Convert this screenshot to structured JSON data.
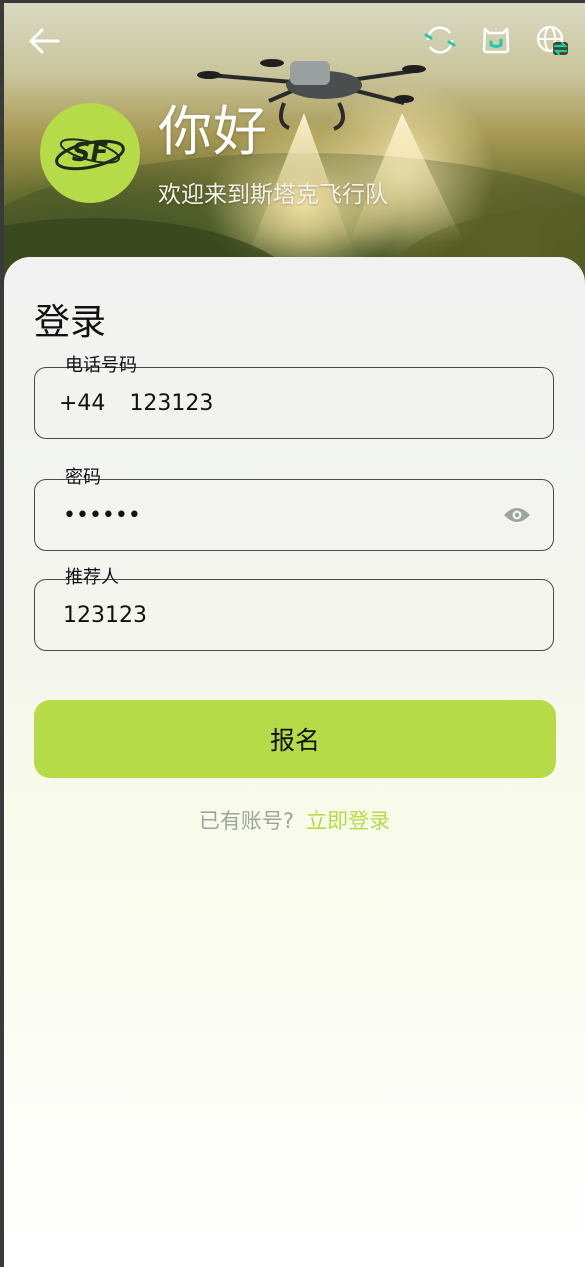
{
  "header": {
    "greeting": "你好",
    "welcome": "欢迎来到斯塔克飞行队",
    "logo_text": "SF",
    "back_icon": "arrow-left-icon",
    "icons": [
      "refresh-icon",
      "support-icon",
      "language-icon"
    ]
  },
  "form": {
    "title": "登录",
    "phone": {
      "label": "电话号码",
      "country_code": "+44",
      "value": "123123"
    },
    "password": {
      "label": "密码",
      "value": "••••••",
      "toggle_icon": "eye-icon"
    },
    "referrer": {
      "label": "推荐人",
      "value": "123123"
    },
    "submit_label": "报名",
    "footer_question": "已有账号?",
    "footer_link": "立即登录"
  },
  "colors": {
    "accent": "#b5dc48",
    "muted": "#9aa69d",
    "icon_teal": "#1fc9b0"
  }
}
